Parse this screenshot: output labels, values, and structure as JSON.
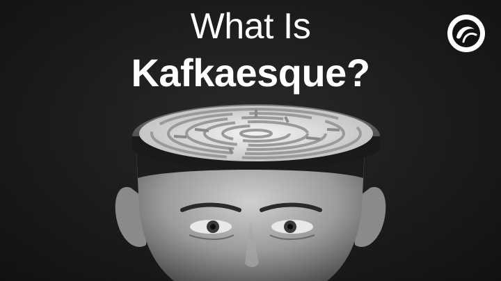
{
  "title": {
    "line1": "What Is",
    "line2": "Kafkaesque?"
  },
  "logo": {
    "icon": "channel-logo-icon"
  },
  "image": {
    "subject": "portrait-with-maze-head"
  }
}
